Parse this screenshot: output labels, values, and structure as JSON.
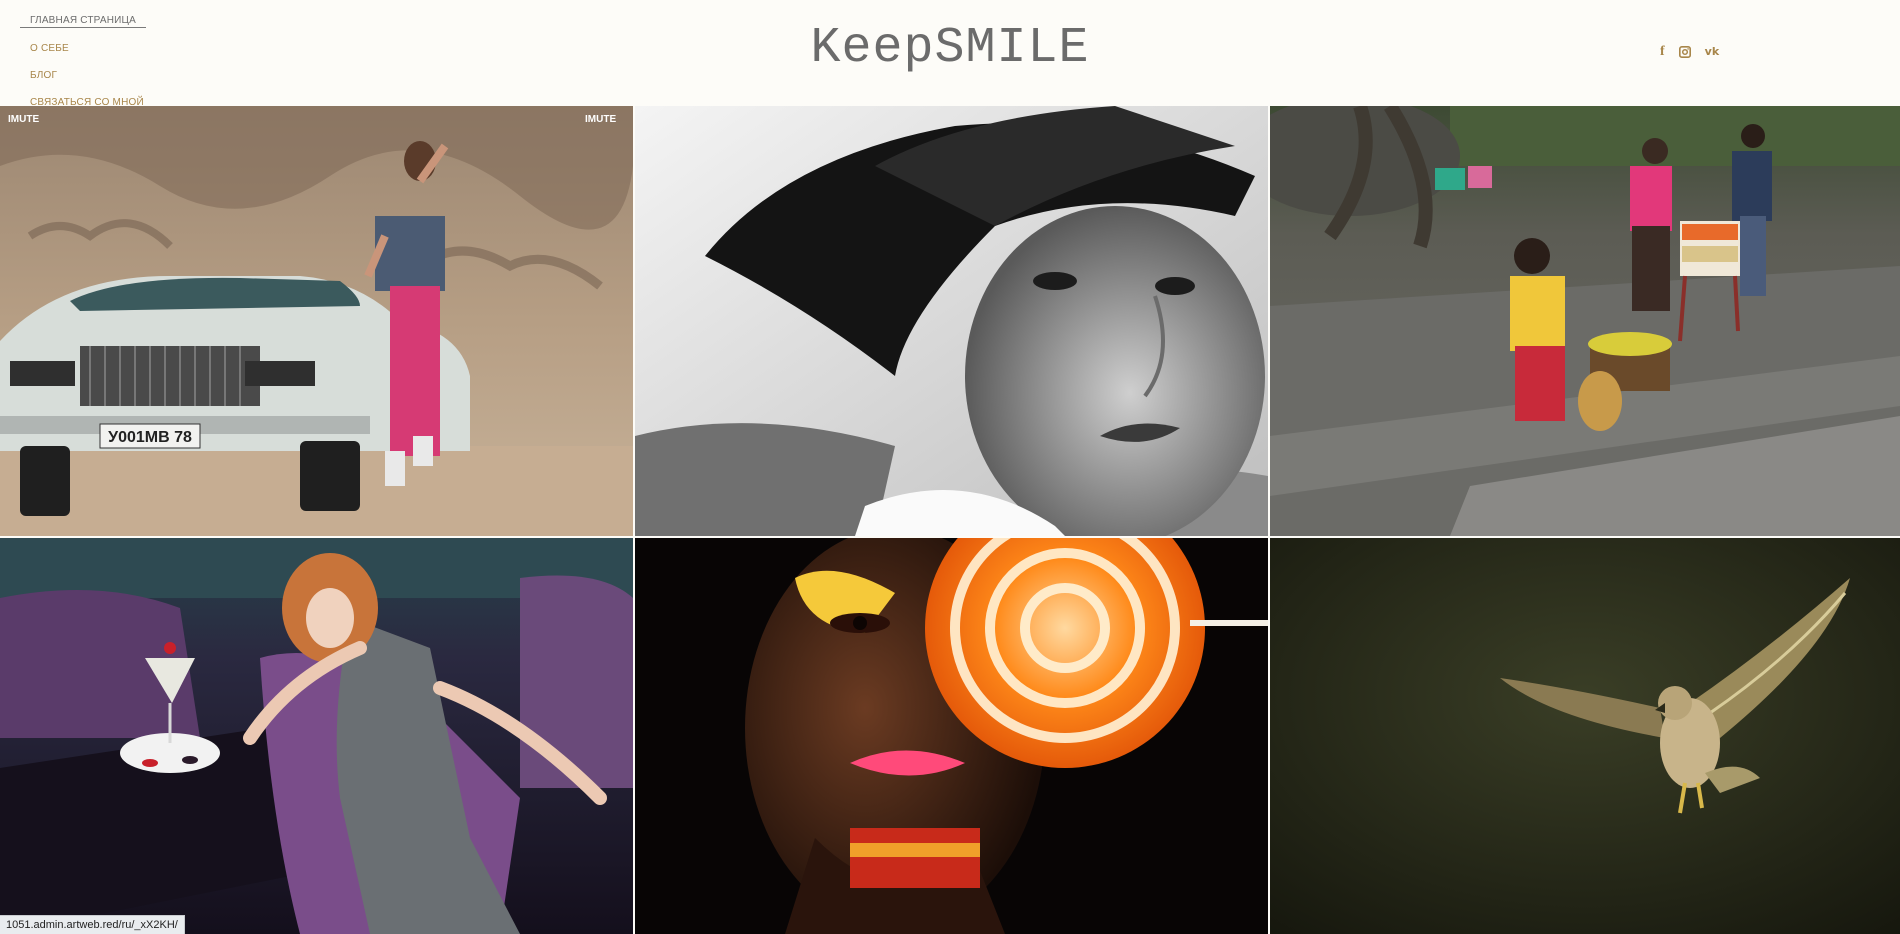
{
  "nav": {
    "items": [
      {
        "label": "ГЛАВНАЯ СТРАНИЦА",
        "active": true
      },
      {
        "label": "О СЕБЕ",
        "active": false
      },
      {
        "label": "БЛОГ",
        "active": false
      },
      {
        "label": "СВЯЗАТЬСЯ СО МНОЙ",
        "active": false
      }
    ]
  },
  "logo": {
    "text": "KeepSMILE"
  },
  "social": {
    "items": [
      {
        "icon": "facebook-icon",
        "glyph": "f"
      },
      {
        "icon": "instagram-icon"
      },
      {
        "icon": "vk-icon",
        "glyph": "vk"
      }
    ]
  },
  "gallery": {
    "tiles": [
      {
        "subject": "fashion-woman-vintage-car",
        "watermark_left": "IMUTE",
        "watermark_right": "IMUTE",
        "plate": "У001МВ 78"
      },
      {
        "subject": "bw-portrait-woman-hat"
      },
      {
        "subject": "street-vendor-scene"
      },
      {
        "subject": "fashion-woman-lounge-chair"
      },
      {
        "subject": "beauty-portrait-lollipop"
      },
      {
        "subject": "hawk-in-flight"
      }
    ]
  },
  "status_bar": {
    "url": "1051.admin.artweb.red/ru/_xX2KH/"
  },
  "colors": {
    "accent": "#a8864a",
    "logo": "#6b6b6b",
    "background": "#fdfcf8"
  }
}
